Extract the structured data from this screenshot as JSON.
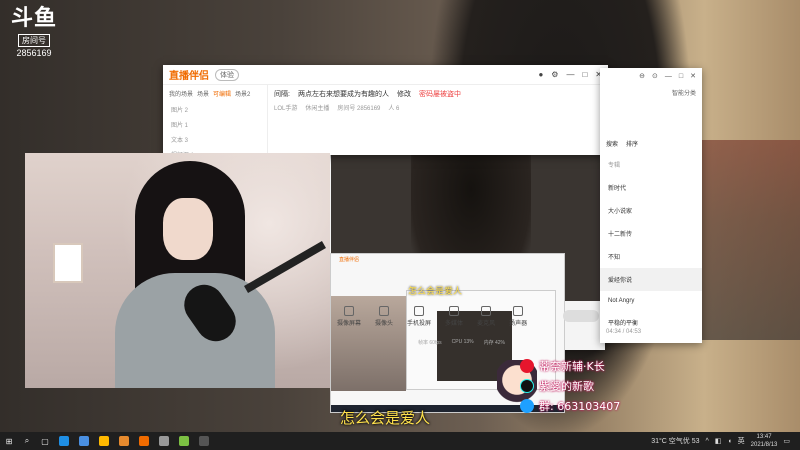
{
  "logo": {
    "mark": "斗鱼",
    "room_label": "房间号",
    "room_id": "2856169"
  },
  "app": {
    "name": "直播伴侣",
    "tag": "体验",
    "left_tabs": [
      "我的场景",
      "场景",
      "可编辑",
      "场景2"
    ],
    "left_rows": [
      "图片 2",
      "图片 1",
      "文本 3",
      "视频源 1"
    ],
    "title_label": "间隔:",
    "title_text": "两点左右来想要成为有趣的人",
    "title_tag": "修改",
    "title_highlight": "密码屡被盗中",
    "sub_items": [
      "LOL手游",
      "休闲主播",
      "房间号 2856169",
      "人 6"
    ]
  },
  "right_panel": {
    "top_buttons": [
      "⊖",
      "⊙",
      "—",
      "□",
      "✕"
    ],
    "sub_left": [
      "⊡",
      "⊕",
      "⊙",
      "⊞",
      "⌂",
      "⟲"
    ],
    "smart_label": "智能分类",
    "tabs": [
      "搜索",
      "排序"
    ],
    "list_heading": "专辑",
    "items": [
      "新时代",
      "大小说家",
      "十二新传",
      "不知",
      "爱经你说",
      "Not Angry",
      "平稳的平衡"
    ],
    "selected_index": 4,
    "footer": "04:34 / 04:53"
  },
  "preview": {
    "logo": "斗鱼",
    "nested_brand": "直播伴侣",
    "toolbar": [
      "摄像屏幕",
      "摄像头",
      "手机投屏",
      "多媒体",
      "麦克风",
      "扬声器"
    ],
    "status": [
      "帧率 60fps",
      "CPU 13%",
      "内存 42%"
    ]
  },
  "mid_caption": "怎么会是爱人",
  "caption": "怎么会是爱人",
  "promo": {
    "weibo": "蒂奈新辅·K长",
    "tiktok": "紫婆的新歌",
    "qq": "群: 663103407"
  },
  "taskbar": {
    "weather": "31°C 空气优 53",
    "lang": "英",
    "time": "13:47",
    "date": "2021/8/13"
  }
}
